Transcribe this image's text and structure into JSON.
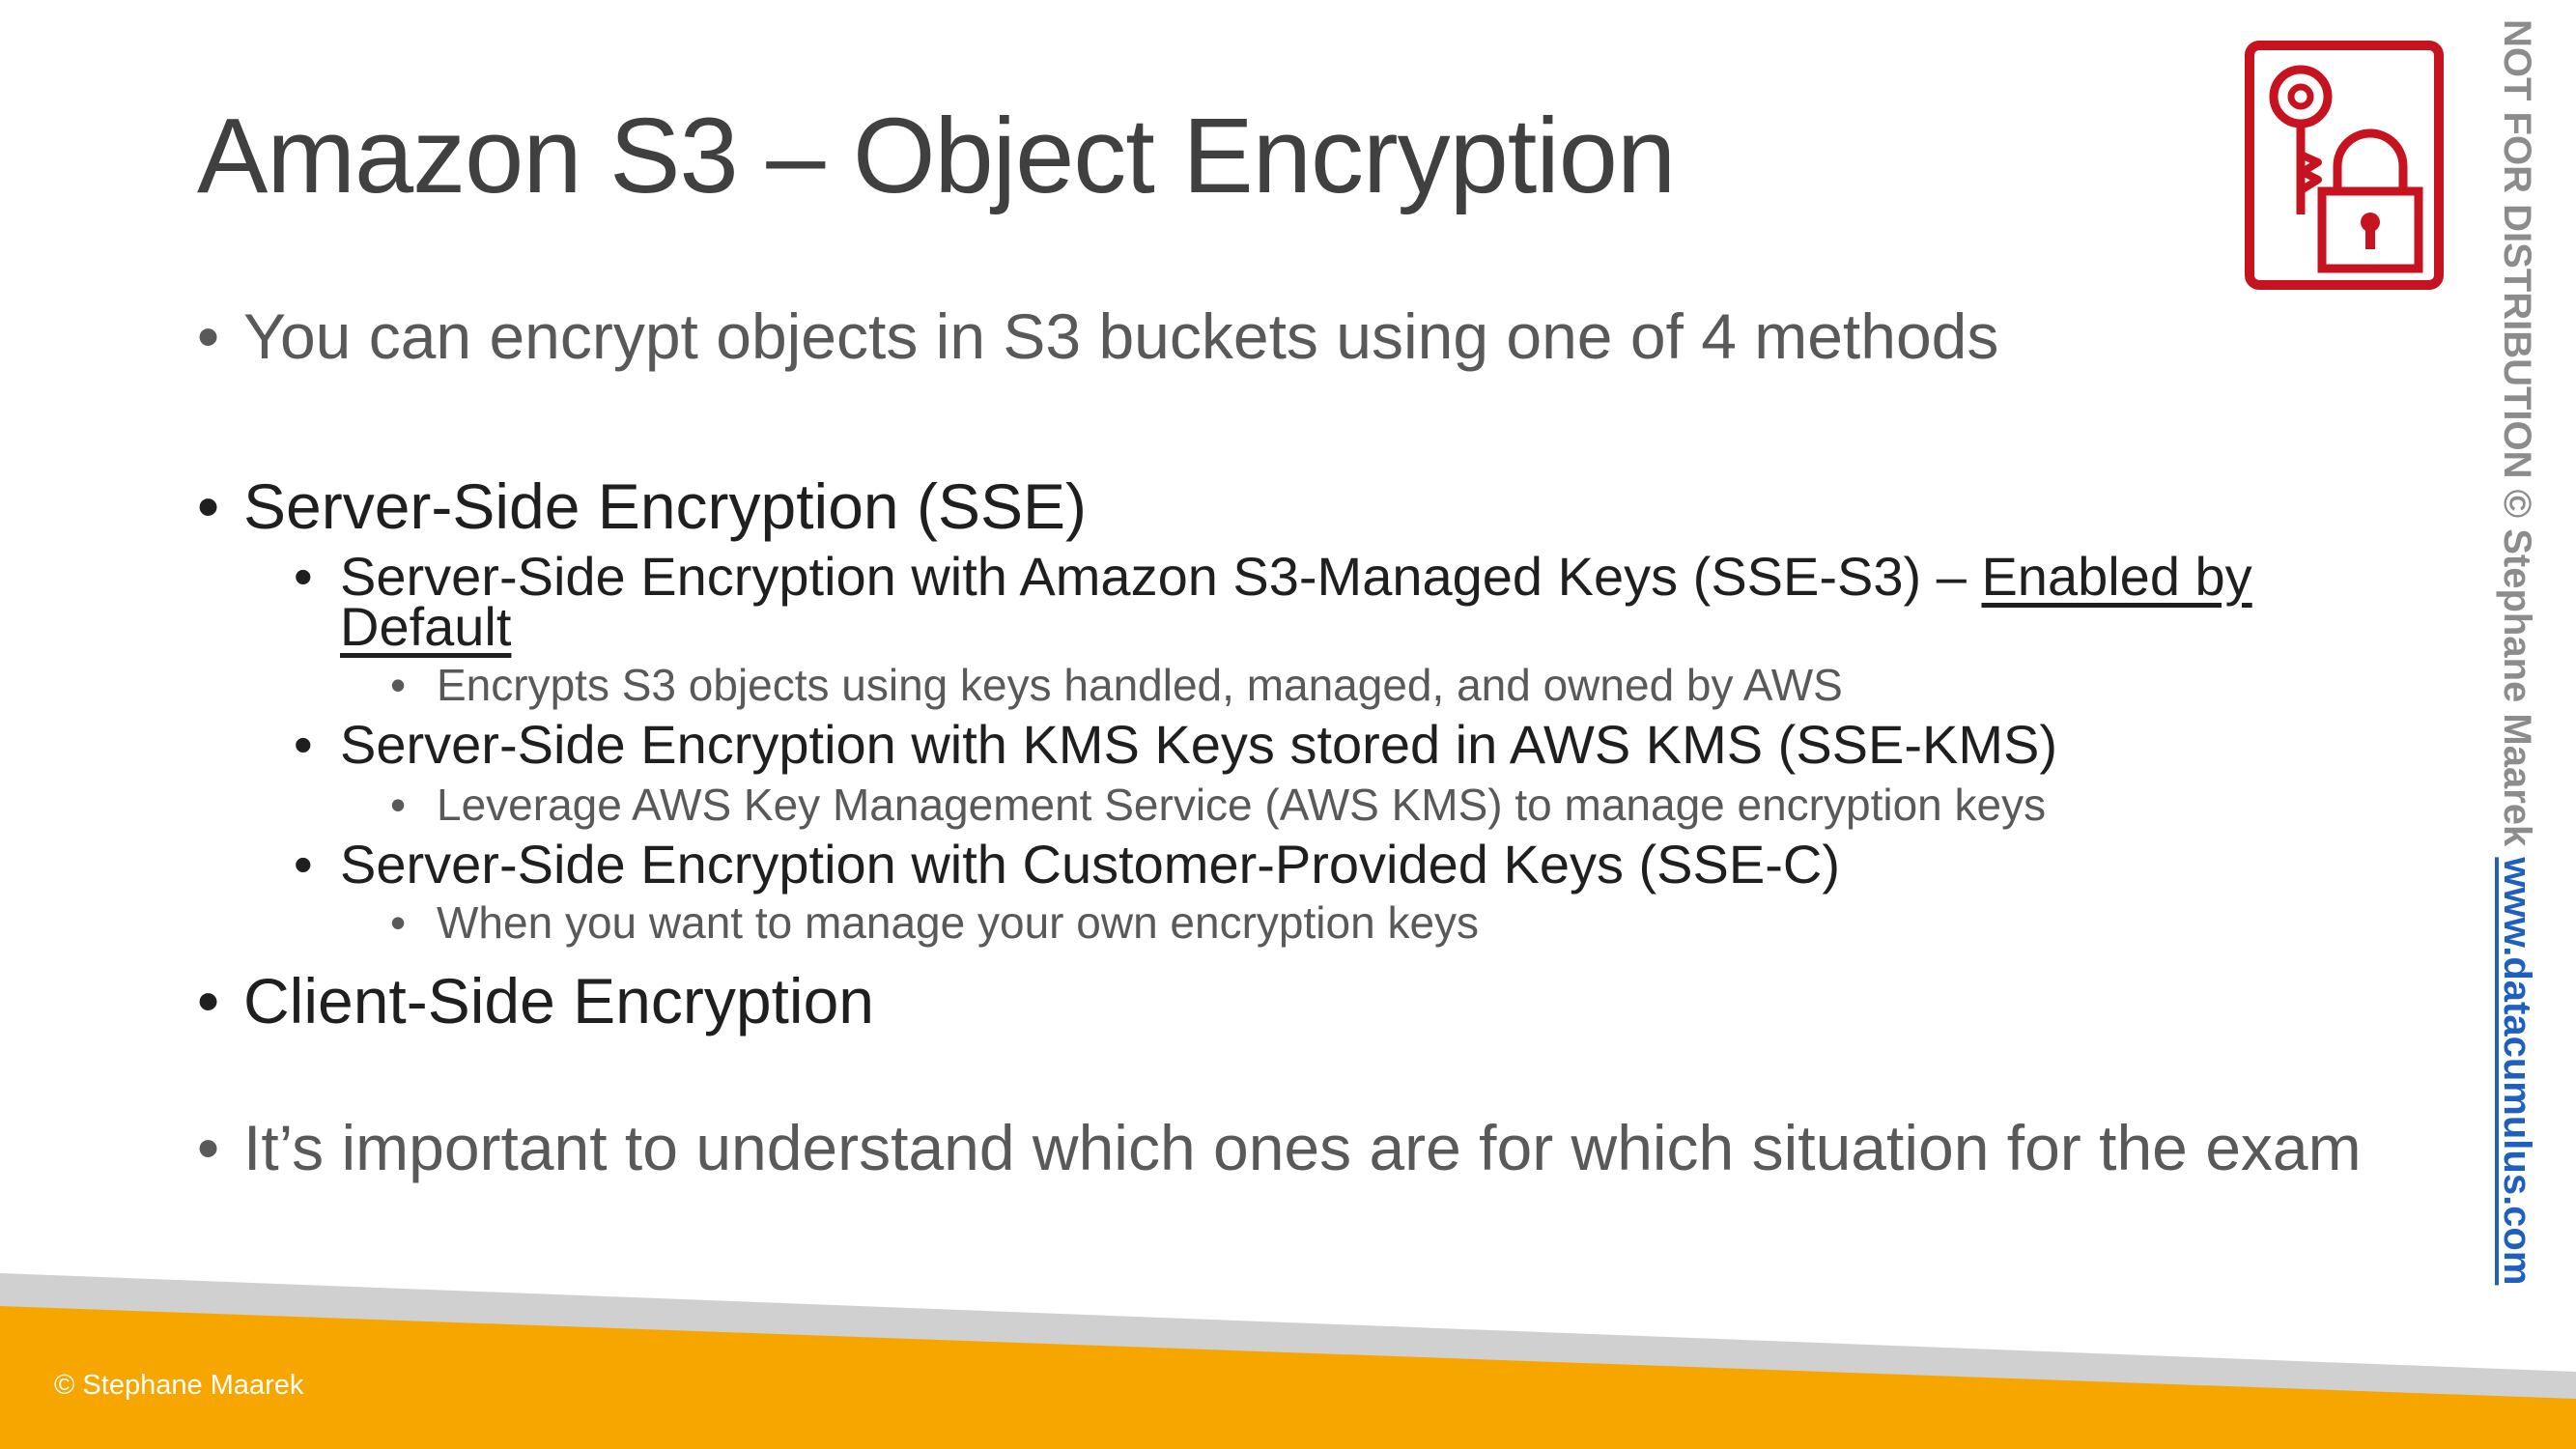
{
  "slide": {
    "title": "Amazon S3 – Object Encryption",
    "bullet_char": "•",
    "bullets": [
      {
        "text": "You can encrypt objects in S3 buckets using one of 4 methods"
      },
      {
        "text": "Server-Side Encryption (SSE)"
      },
      {
        "text": "Server-Side Encryption with Amazon S3-Managed Keys (SSE-S3) – ",
        "link_line1": "Enabled by",
        "link_line2": "Default"
      },
      {
        "text": "Encrypts S3 objects using keys handled, managed, and owned by AWS"
      },
      {
        "text": "Server-Side Encryption with KMS Keys stored in AWS KMS (SSE-KMS)"
      },
      {
        "text": "Leverage AWS Key Management Service (AWS KMS) to manage encryption keys"
      },
      {
        "text": "Server-Side Encryption with Customer-Provided Keys (SSE-C)"
      },
      {
        "text": "When you want to manage your own encryption keys"
      },
      {
        "text": "Client-Side Encryption"
      },
      {
        "text": "It’s important to understand which ones are for which situation for the exam"
      }
    ]
  },
  "footer": {
    "copyright": "© Stephane Maarek"
  },
  "watermark": {
    "notice": "NOT FOR DISTRIBUTION © Stephane Maarek ",
    "url": "www.datacumulus.com"
  },
  "icon": {
    "name": "key-lock-icon",
    "color": "#c7131f"
  },
  "colors": {
    "accent_orange": "#f7a600",
    "stripe_gray": "#d0d0d0"
  }
}
